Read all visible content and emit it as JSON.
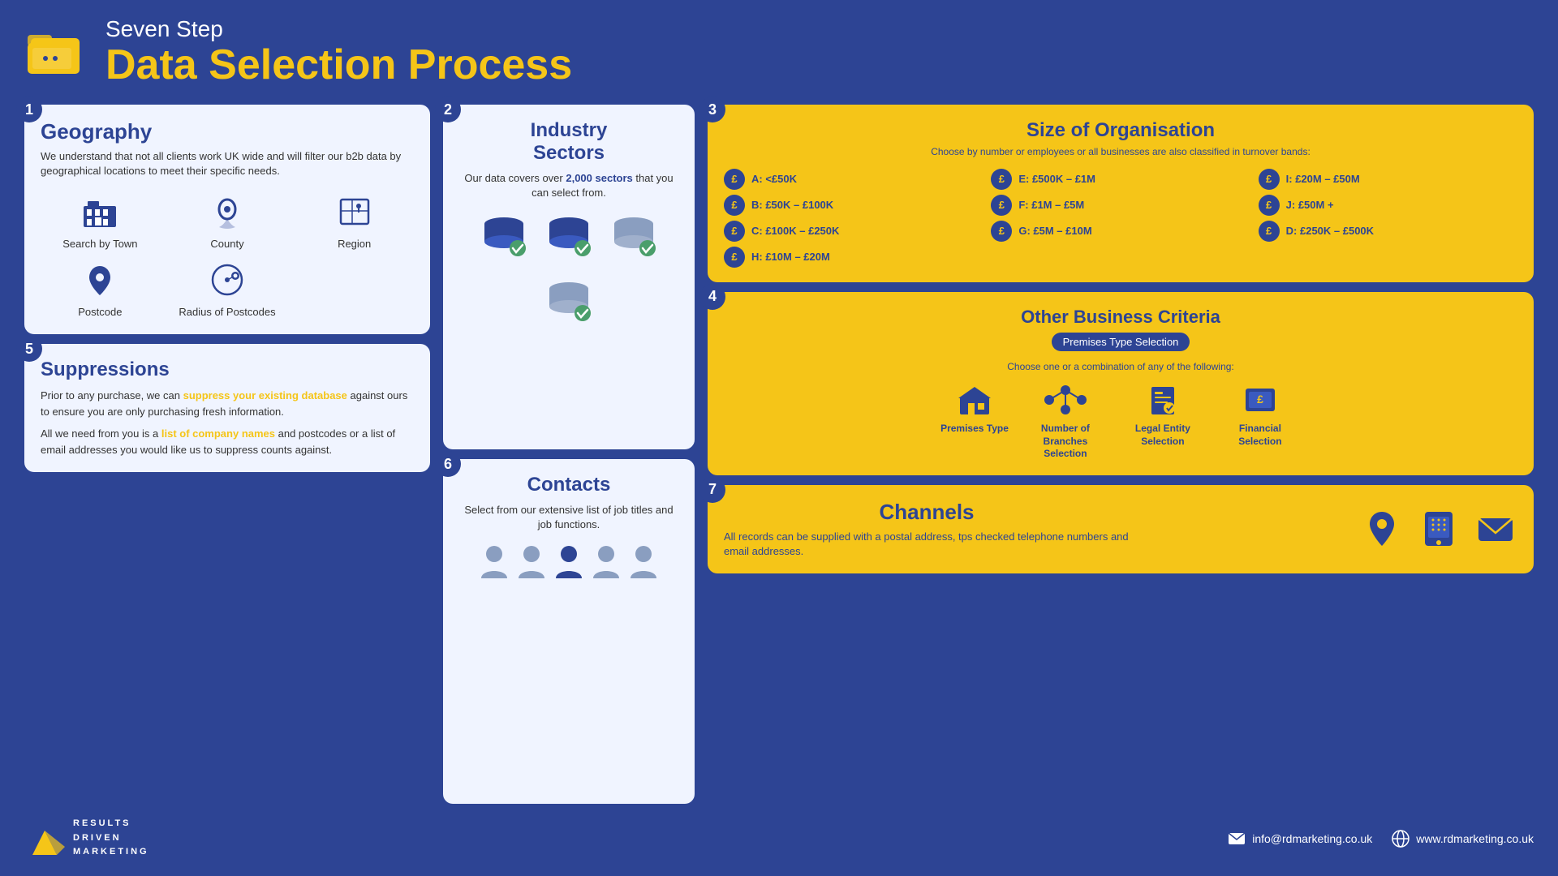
{
  "header": {
    "subtitle": "Seven Step",
    "title": "Data Selection Process"
  },
  "steps": {
    "geography": {
      "step": "1",
      "title": "Geography",
      "description": "We understand that not all clients work UK wide and will filter our b2b data by geographical locations to meet their specific needs.",
      "items": [
        {
          "label": "Search by Town"
        },
        {
          "label": "County"
        },
        {
          "label": "Region"
        },
        {
          "label": "Postcode"
        },
        {
          "label": "Radius of Postcodes"
        }
      ]
    },
    "industry": {
      "step": "2",
      "title": "Industry Sectors",
      "description": "Our data covers over 2,000 sectors that you can select from.",
      "highlight": "2,000"
    },
    "size": {
      "step": "3",
      "title": "Size of Organisation",
      "subtitle": "Choose by number or employees or all businesses are also classified in turnover bands:",
      "bands": [
        {
          "label": "A: <£50K"
        },
        {
          "label": "B: £50K – £100K"
        },
        {
          "label": "C: £100K – £250K"
        },
        {
          "label": "D: £250K – £500K"
        },
        {
          "label": "E: £500K – £1M"
        },
        {
          "label": "F: £1M – £5M"
        },
        {
          "label": "G: £5M – £10M"
        },
        {
          "label": "H: £10M – £20M"
        },
        {
          "label": "I: £20M – £50M"
        },
        {
          "label": "J: £50M +"
        }
      ]
    },
    "other": {
      "step": "4",
      "title": "Other Business Criteria",
      "badge": "Premises Type Selection",
      "subtitle": "Choose one or a combination of any of the following:",
      "items": [
        {
          "label": "Premises Type"
        },
        {
          "label": "Number of Branches Selection"
        },
        {
          "label": "Legal Entity Selection"
        },
        {
          "label": "Financial Selection"
        }
      ]
    },
    "suppressions": {
      "step": "5",
      "title": "Suppressions",
      "para1": "Prior to any purchase, we can suppress your existing database against ours to ensure you are only purchasing fresh information.",
      "para2_prefix": "All we need from you is a ",
      "para2_link": "list of company names",
      "para2_suffix": " and postcodes or a list of email addresses you would like us to suppress counts against.",
      "suppress_highlight": "suppress your existing database"
    },
    "contacts": {
      "step": "6",
      "title": "Contacts",
      "description": "Select from our extensive list of job titles and job functions."
    },
    "channels": {
      "step": "7",
      "title": "Channels",
      "description": "All records can be supplied with a postal address, tps checked telephone numbers and email addresses."
    }
  },
  "footer": {
    "logo_line1": "RESULTS",
    "logo_line2": "DRIVEN",
    "logo_line3": "MARKETING",
    "email": "info@rdmarketing.co.uk",
    "website": "www.rdmarketing.co.uk"
  }
}
